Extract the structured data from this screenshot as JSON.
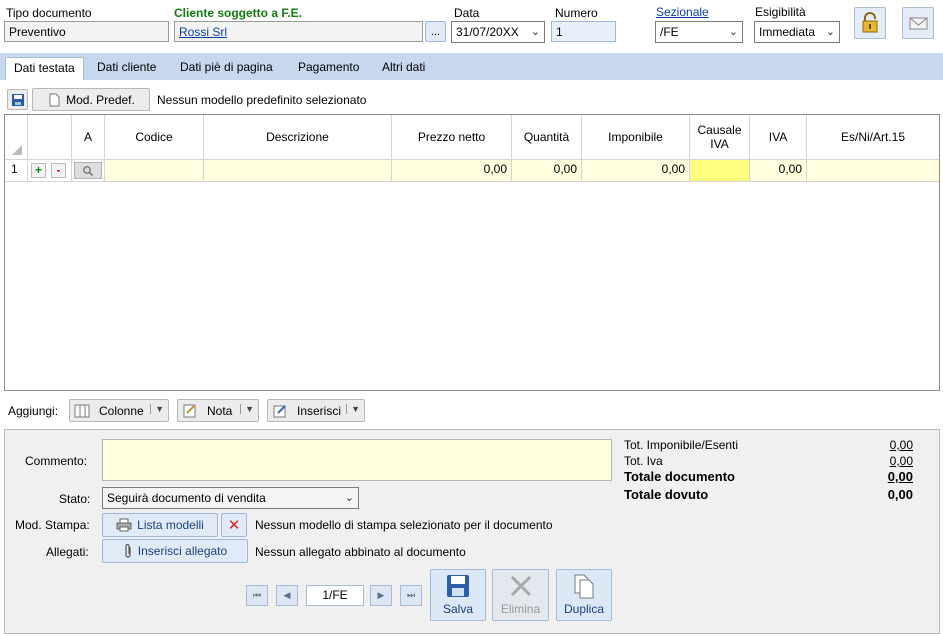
{
  "header": {
    "tipo_label": "Tipo documento",
    "tipo_value": "Preventivo",
    "cliente_label": "Cliente soggetto a F.E.",
    "cliente_value": "Rossi Srl",
    "cliente_btn": "...",
    "data_label": "Data",
    "data_value": "31/07/20XX",
    "numero_label": "Numero",
    "numero_value": "1",
    "sezionale_label": "Sezionale",
    "sezionale_value": "/FE",
    "esigibilita_label": "Esigibilità",
    "esigibilita_value": "Immediata"
  },
  "tabs": [
    {
      "label": "Dati testata"
    },
    {
      "label": "Dati cliente"
    },
    {
      "label": "Dati piè di pagina"
    },
    {
      "label": "Pagamento"
    },
    {
      "label": "Altri dati"
    }
  ],
  "toolbar": {
    "mod_predef_label": "Mod. Predef.",
    "mod_predef_status": "Nessun modello predefinito selezionato"
  },
  "grid": {
    "columns": [
      "A",
      "Codice",
      "Descrizione",
      "Prezzo netto",
      "Quantità",
      "Imponibile",
      "Causale IVA",
      "IVA",
      "Es/Ni/Art.15"
    ],
    "row": {
      "num": "1",
      "plus": "+",
      "minus": "-",
      "prezzo": "0,00",
      "quantita": "0,00",
      "imponibile": "0,00",
      "iva": "0,00"
    }
  },
  "aggiungi": {
    "label": "Aggiungi:",
    "colonne": "Colonne",
    "nota": "Nota",
    "inserisci": "Inserisci"
  },
  "footer": {
    "commento_label": "Commento:",
    "stato_label": "Stato:",
    "stato_value": "Seguirà documento di vendita",
    "mod_stampa_label": "Mod. Stampa:",
    "lista_modelli": "Lista modelli",
    "mod_stampa_status": "Nessun modello di stampa selezionato per il documento",
    "allegati_label": "Allegati:",
    "inserisci_allegato": "Inserisci allegato",
    "allegati_status": "Nessun allegato abbinato al documento"
  },
  "totals": {
    "imponibile_label": "Tot. Imponibile/Esenti",
    "imponibile_value": "0,00",
    "iva_label": "Tot. Iva",
    "iva_value": "0,00",
    "documento_label": "Totale documento",
    "documento_value": "0,00",
    "dovuto_label": "Totale dovuto",
    "dovuto_value": "0,00"
  },
  "nav": {
    "record_value": "1/FE",
    "salva": "Salva",
    "elimina": "Elimina",
    "duplica": "Duplica"
  },
  "colors": {
    "accent": "#107c10",
    "tabbar": "#c7d8ee",
    "row_highlight": "#ffffe0",
    "causale_cell": "#ffff80"
  }
}
